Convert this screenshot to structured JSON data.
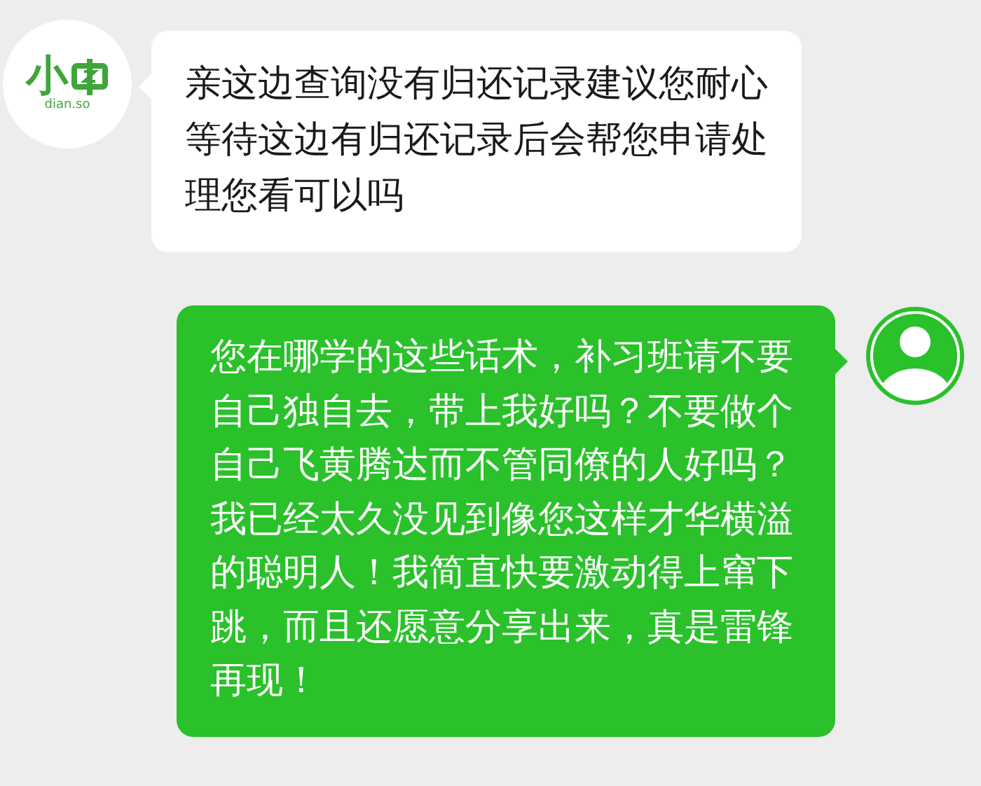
{
  "messages": [
    {
      "kind": "received",
      "logo": {
        "mark": "小",
        "domain": "dian.so"
      },
      "text": "亲这边查询没有归还记录建议您耐心等待这边有归还记录后会帮您申请处理您看可以吗"
    },
    {
      "kind": "sent",
      "text": "您在哪学的这些话术，补习班请不要自己独自去，带上我好吗？不要做个自己飞黄腾达而不管同僚的人好吗？我已经太久没见到像您这样才华横溢的聪明人！我简直快要激动得上窜下跳，而且还愿意分享出来，真是雷锋再现！"
    }
  ]
}
